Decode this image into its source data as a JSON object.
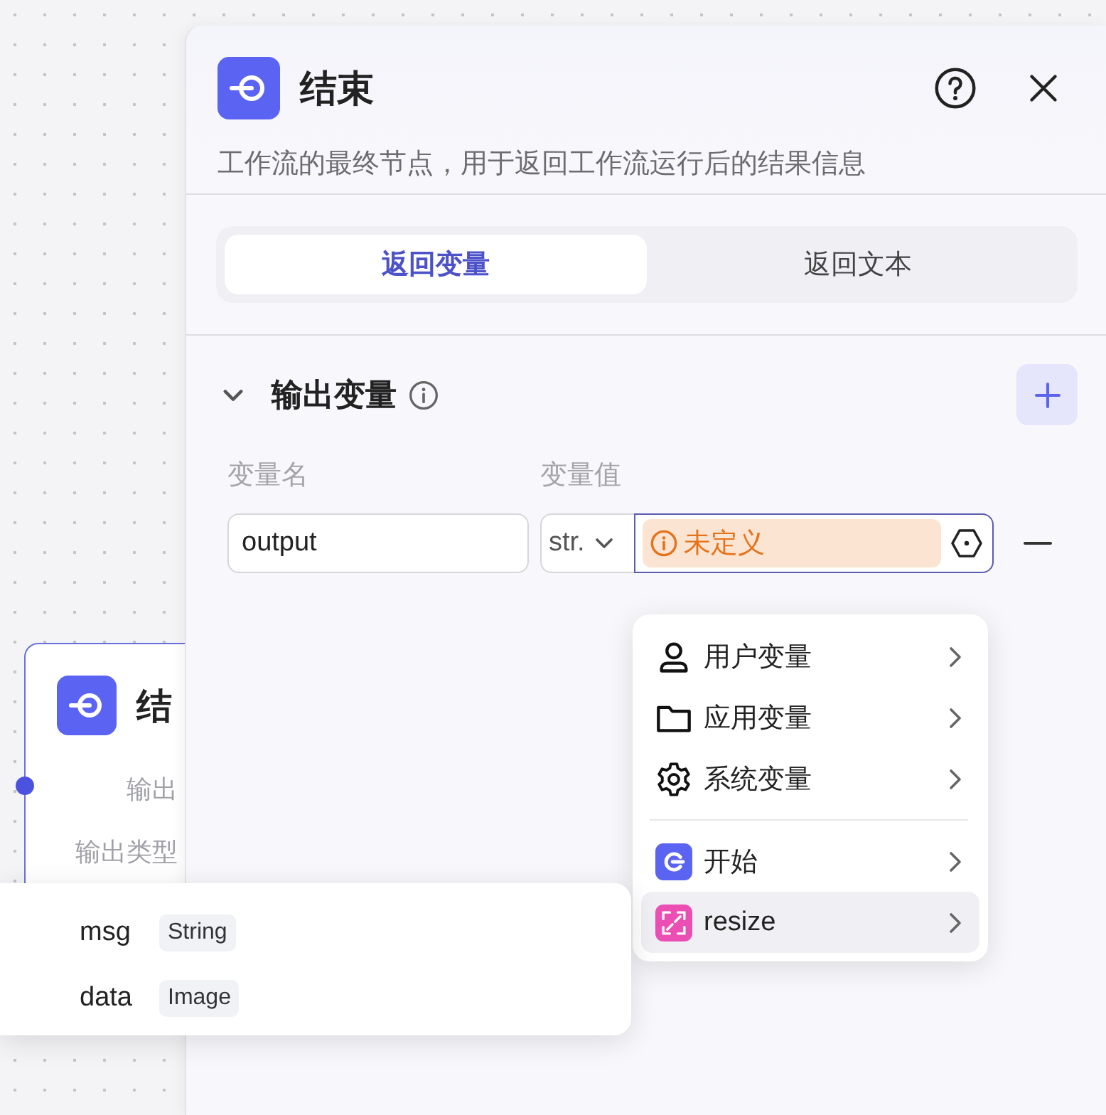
{
  "node": {
    "title": "结",
    "labels": [
      "输出",
      "输出类型"
    ]
  },
  "panel": {
    "title": "结束",
    "description": "工作流的最终节点，用于返回工作流运行后的结果信息",
    "tabs": [
      {
        "label": "返回变量",
        "selected": true
      },
      {
        "label": "返回文本",
        "selected": false
      }
    ],
    "section": {
      "title": "输出变量",
      "expanded": true,
      "columns": [
        "变量名",
        "变量值"
      ],
      "rows": [
        {
          "name": "output",
          "type": "str.",
          "value": {
            "text": "未定义",
            "kind": "warning"
          }
        }
      ]
    }
  },
  "menu": {
    "groups": [
      {
        "items": [
          {
            "label": "用户变量",
            "kind": "user",
            "highlighted": false
          },
          {
            "label": "应用变量",
            "kind": "folder",
            "highlighted": false
          },
          {
            "label": "系统变量",
            "kind": "gear",
            "highlighted": false
          }
        ]
      },
      {
        "items": [
          {
            "label": "开始",
            "kind": "start",
            "color": "#5b63f2",
            "highlighted": false
          },
          {
            "label": "resize",
            "kind": "expand",
            "color": "#ec4fb4",
            "highlighted": true
          }
        ]
      }
    ]
  },
  "submenu": {
    "items": [
      {
        "name": "msg",
        "type": "String"
      },
      {
        "name": "data",
        "type": "Image"
      }
    ]
  }
}
